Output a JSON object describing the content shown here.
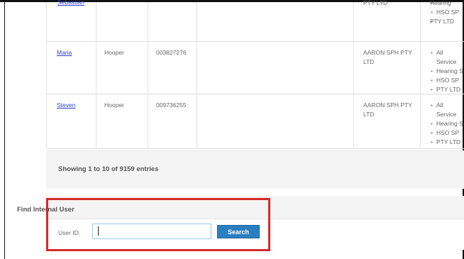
{
  "table": {
    "rows": [
      {
        "first_name": "Sebastian",
        "last_name": "",
        "user_id": "",
        "company": "PTY LTD",
        "orgs": [
          "Hearing",
          "HSO SP",
          "PTY LTD"
        ]
      },
      {
        "first_name": "Maria",
        "last_name": "Hooper",
        "user_id": "003827276",
        "company": "AARON SPH PTY LTD",
        "orgs": [
          "All Service",
          "Hearing S",
          "HSO SP",
          "PTY LTD"
        ]
      },
      {
        "first_name": "Steven",
        "last_name": "Hooper",
        "user_id": "009736255",
        "company": "AARON SPH PTY LTD",
        "orgs": [
          "All Service",
          "Hearing S",
          "HSO SP",
          "PTY LTD"
        ]
      }
    ]
  },
  "info": {
    "text": "Showing 1 to 10 of 9159 entries"
  },
  "find_internal_user": {
    "title": "Find Internal User",
    "label": "User ID:",
    "input_value": "",
    "button_label": "Search"
  },
  "colors": {
    "highlight": "#d42a2a",
    "button": "#2a7fc1",
    "link": "#2a3fd6"
  }
}
